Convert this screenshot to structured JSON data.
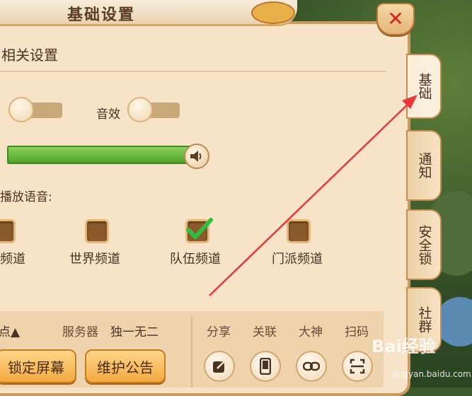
{
  "window": {
    "title": "基础设置",
    "close_label": "✕"
  },
  "section": {
    "title": "相关设置"
  },
  "toggles": {
    "sound_effect_label": "音效"
  },
  "auto_play": {
    "label": "播放语音:"
  },
  "channels": [
    {
      "label": "频道",
      "checked": false
    },
    {
      "label": "世界频道",
      "checked": false
    },
    {
      "label": "队伍频道",
      "checked": true
    },
    {
      "label": "门派频道",
      "checked": false
    }
  ],
  "bottom": {
    "partial_label": "点▲",
    "server_label": "服务器",
    "server_value": "独一无二",
    "lock_screen": "锁定屏幕",
    "maintenance_notice": "维护公告",
    "share": "分享",
    "link": "关联",
    "master": "大神",
    "scan": "扫码"
  },
  "tabs": [
    {
      "label": "基础",
      "active": true
    },
    {
      "label": "通知",
      "active": false
    },
    {
      "label": "安全锁",
      "active": false
    },
    {
      "label": "社群",
      "active": false
    }
  ],
  "watermark": {
    "brand": "Bai经验",
    "url": "jingyan.baidu.com"
  },
  "colors": {
    "accent": "#f3aa3f",
    "slider": "#5bb32f",
    "close": "#d9201c",
    "annotation_arrow": "#e8383a"
  }
}
